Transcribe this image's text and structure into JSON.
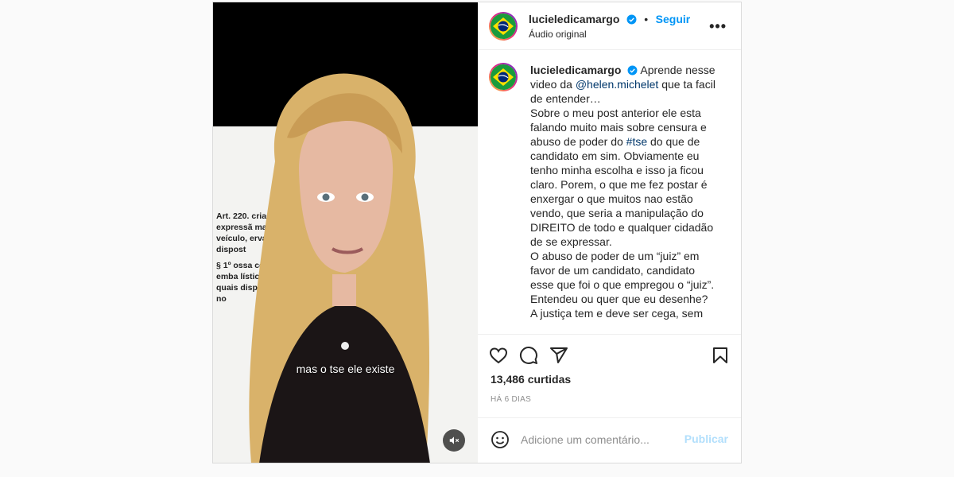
{
  "post": {
    "username": "lucieledicamargo",
    "follow_label": "Seguir",
    "separator": "•",
    "audio_label": "Áudio original",
    "more_label": "•••",
    "video": {
      "subtitle": "mas o tse ele existe",
      "doc_lines": [
        "Art. 220.                           criação, a",
        "expressã                          ma, processo ou",
        "veículo,                           ervado o",
        "dispost",
        "  § 1º                            ossa constituir",
        "emba                              lística em",
        "quais                              disposto",
        "no"
      ]
    },
    "caption": {
      "before_mention": "Aprende nesse video da ",
      "mention": "@helen.michelet",
      "after_mention": " que ta facil de entender…",
      "p1_before_tag": "Sobre o meu post anterior ele esta falando muito mais sobre censura e abuso de poder do ",
      "hashtag": "#tse",
      "p1_after_tag": " do que de candidato em sim. Obviamente eu tenho minha escolha e isso ja ficou claro. Porem, o que me fez postar é enxergar o que muitos nao estão vendo, que seria a manipulação do DIREITO de todo e qualquer cidadão de se expressar.",
      "p2": "O abuso de poder de um “juiz” em favor de um candidato, candidato esse que foi o que empregou o “juiz”. Entendeu ou quer que eu desenhe?",
      "p3": "A justiça tem e deve ser cega, sem"
    },
    "likes": "13,486 curtidas",
    "date": "HÁ 6 DIAS",
    "comment_placeholder": "Adicione um comentário...",
    "publish_label": "Publicar"
  },
  "colors": {
    "accent": "#0095f6",
    "link": "#00376b",
    "muted": "#8e8e8e",
    "publish_disabled": "#b2dffc"
  },
  "icons": [
    "verified-badge-icon",
    "more-options-icon",
    "heart-icon",
    "comment-icon",
    "share-icon",
    "bookmark-icon",
    "emoji-icon",
    "muted-audio-icon",
    "brazil-flag-icon"
  ]
}
